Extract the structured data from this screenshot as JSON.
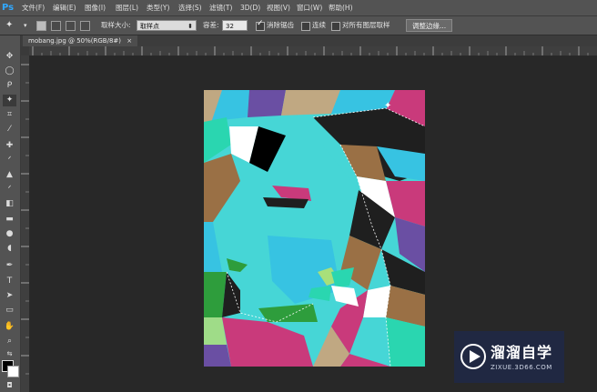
{
  "app": {
    "logo": "Ps"
  },
  "menubar": {
    "items": [
      "文件(F)",
      "编辑(E)",
      "图像(I)",
      "图层(L)",
      "类型(Y)",
      "选择(S)",
      "滤镜(T)",
      "3D(D)",
      "视图(V)",
      "窗口(W)",
      "帮助(H)"
    ]
  },
  "options": {
    "sample_size_label": "取样大小:",
    "sample_size_value": "取样点",
    "tolerance_label": "容差:",
    "tolerance_value": "32",
    "antialias_label": "消除锯齿",
    "antialias_checked": true,
    "contiguous_label": "连续",
    "contiguous_checked": false,
    "all_layers_label": "对所有图层取样",
    "all_layers_checked": false,
    "refine_edge_label": "调整边缘..."
  },
  "document": {
    "tab_title": "mobang.jpg @ 50%(RGB/8#)",
    "close_glyph": "×"
  },
  "watermark": {
    "title": "溜溜自学",
    "subtitle": "ZIXUE.3D66.COM"
  },
  "icons": {
    "magic_wand": "magic-wand-icon",
    "watermark_logo": "play-logo-icon"
  }
}
